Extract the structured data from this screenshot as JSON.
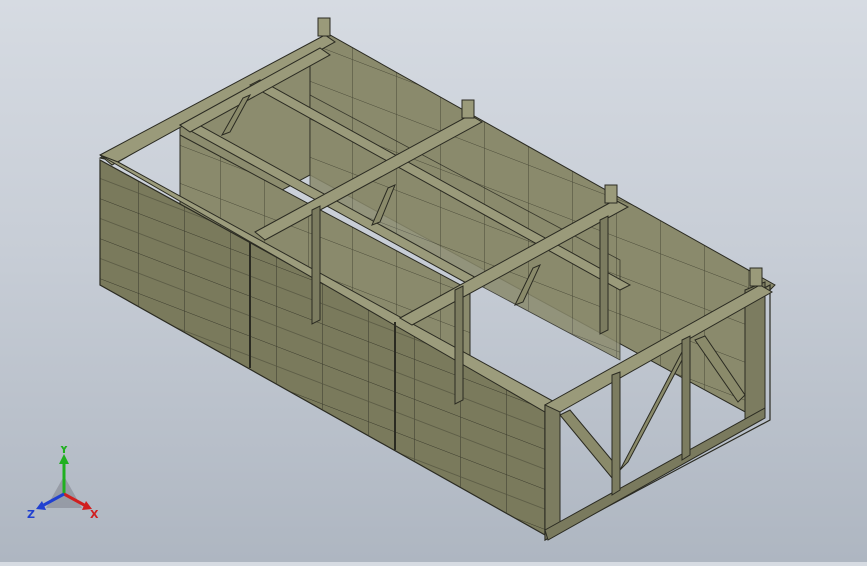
{
  "viewport": {
    "model": "steel-frame-tank-assembly",
    "background": "#c9cfd8"
  },
  "colors": {
    "panel_face": "#7a7a5c",
    "panel_dark": "#5d5d45",
    "panel_top": "#8a8a6a",
    "frame": "#6d6d55",
    "line": "#2b2b22"
  },
  "triad": {
    "x_label": "X",
    "y_label": "Y",
    "z_label": "Z",
    "x_color": "#d02020",
    "y_color": "#20b020",
    "z_color": "#2040d0"
  }
}
